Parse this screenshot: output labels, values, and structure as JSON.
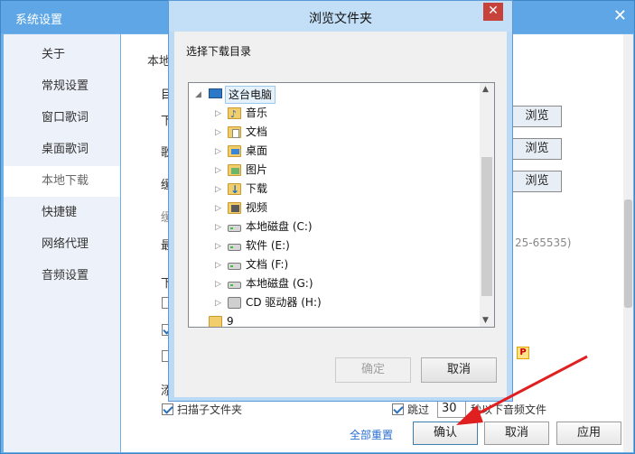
{
  "settings": {
    "title": "系统设置",
    "close_glyph": "✕",
    "sidebar": [
      {
        "label": "关于"
      },
      {
        "label": "常规设置"
      },
      {
        "label": "窗口歌词"
      },
      {
        "label": "桌面歌词"
      },
      {
        "label": "本地下载"
      },
      {
        "label": "快捷键"
      },
      {
        "label": "网络代理"
      },
      {
        "label": "音频设置"
      }
    ],
    "content": {
      "section_title_fragment": "本地",
      "frag_1": "目",
      "frag_2": "下",
      "frag_3": "歌",
      "frag_4": "缓",
      "frag_5": "缓",
      "frag_6": "最",
      "frag_7": "下",
      "frag_8": "添",
      "browse_1": "浏览",
      "browse_2": "浏览",
      "browse_3": "浏览",
      "port_range": "25-65535)",
      "scan_subfolders": "扫描子文件夹",
      "skip_label": "跳过",
      "skip_value": "30",
      "skip_suffix": "秒以下音频文件",
      "badge": "P"
    },
    "footer": {
      "reset_all": "全部重置",
      "ok": "确认",
      "cancel": "取消",
      "apply": "应用"
    }
  },
  "dialog": {
    "title": "浏览文件夹",
    "close_glyph": "✕",
    "prompt": "选择下载目录",
    "tree": [
      {
        "label": "这台电脑",
        "icon": "computer-icon"
      },
      {
        "label": "音乐",
        "icon": "music-folder-icon"
      },
      {
        "label": "文档",
        "icon": "documents-folder-icon"
      },
      {
        "label": "桌面",
        "icon": "desktop-folder-icon"
      },
      {
        "label": "图片",
        "icon": "pictures-folder-icon"
      },
      {
        "label": "下载",
        "icon": "downloads-folder-icon"
      },
      {
        "label": "视频",
        "icon": "videos-folder-icon"
      },
      {
        "label": "本地磁盘 (C:)",
        "icon": "drive-icon"
      },
      {
        "label": "软件 (E:)",
        "icon": "drive-icon"
      },
      {
        "label": "文档 (F:)",
        "icon": "drive-icon"
      },
      {
        "label": "本地磁盘 (G:)",
        "icon": "drive-icon"
      },
      {
        "label": "CD 驱动器 (H:)",
        "icon": "cd-drive-icon"
      },
      {
        "label": "9",
        "icon": "folder-icon"
      }
    ],
    "ok": "确定",
    "cancel": "取消"
  },
  "colors": {
    "title_bar": "#5ea6e6",
    "dialog_bg": "#bcdaf6",
    "close_red": "#c6423a",
    "annotation_arrow": "#e02020"
  }
}
